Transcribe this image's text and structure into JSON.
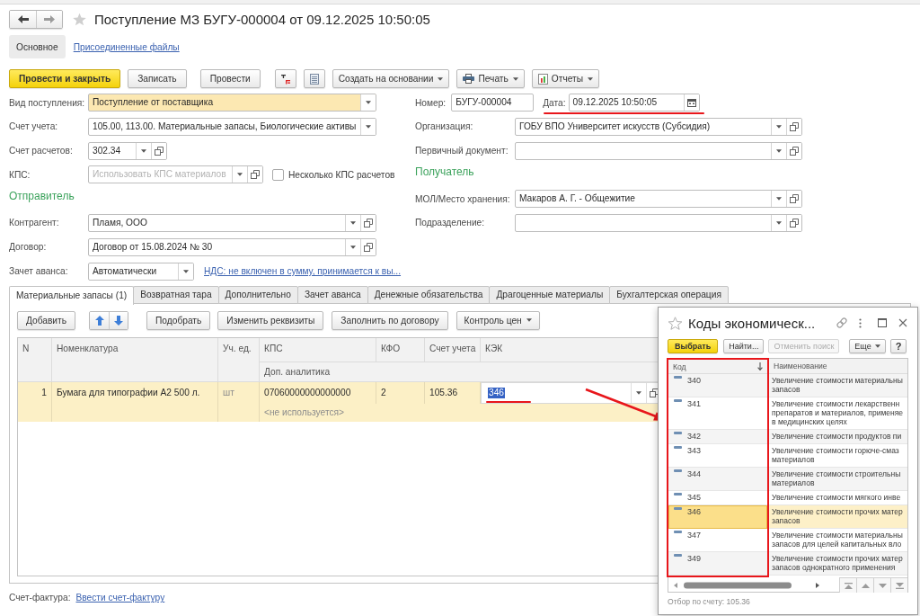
{
  "window": {
    "title": "Поступление МЗ БУГУ-000004 от 09.12.2025 10:50:05",
    "favorite": false
  },
  "nav_tabs": [
    {
      "label": "Основное",
      "selected": true
    },
    {
      "label": "Присоединенные файлы",
      "selected": false
    }
  ],
  "toolbar": {
    "buttons": [
      {
        "label": "Провести и закрыть",
        "default": true
      },
      {
        "label": "Записать",
        "default": false
      },
      {
        "label": "Провести",
        "default": false
      }
    ],
    "menus": [
      {
        "kind": "plain",
        "label": "Создать на основании"
      },
      {
        "kind": "print",
        "label": "Печать"
      },
      {
        "kind": "reports",
        "label": "Отчеты"
      }
    ]
  },
  "left_form": [
    {
      "kind": "select",
      "label": "Вид поступления:",
      "value": "Поступление от поставщика",
      "highlighted": true
    },
    {
      "kind": "select",
      "label": "Счет учета:",
      "value": "105.00, 113.00. Материальные запасы, Биологические активы",
      "highlighted": false
    },
    {
      "kind": "reference",
      "label": "Счет расчетов:",
      "value": "302.34",
      "highlighted": false
    },
    {
      "kind": "reference",
      "label": "КПС:",
      "placeholder": "Использовать КПС материалов",
      "highlighted": false,
      "checkbox": {
        "label": "Несколько КПС расчетов",
        "checked": false
      }
    },
    {
      "kind": "heading",
      "label": "Отправитель"
    },
    {
      "kind": "reference",
      "label": "Контрагент:",
      "value": "Пламя, ООО",
      "highlighted": false
    },
    {
      "kind": "reference",
      "label": "Договор:",
      "value": "Договор от 15.08.2024 № 30",
      "highlighted": false
    },
    {
      "kind": "select",
      "label": "Зачет аванса:",
      "value": "Автоматически",
      "highlighted": false,
      "link": "НДС: не включен в сумму, принимается к вы..."
    }
  ],
  "right_form": [
    {
      "kind": "number_date",
      "number": {
        "label": "Номер:",
        "value": "БУГУ-000004"
      },
      "date": {
        "label": "Дата:",
        "value": "09.12.2025 10:50:05",
        "marked": true
      }
    },
    {
      "kind": "reference",
      "label": "Организация:",
      "value": "ГОБУ ВПО Университет искусств (Субсидия)",
      "highlighted": false
    },
    {
      "kind": "reference",
      "label": "Первичный документ:",
      "highlighted": false
    },
    {
      "kind": "heading",
      "label": "Получатель"
    },
    {
      "kind": "reference",
      "label": "МОЛ/Место хранения:",
      "value": "Макаров А. Г. - Общежитие",
      "highlighted": false
    },
    {
      "kind": "reference",
      "label": "Подразделение:",
      "highlighted": false
    }
  ],
  "section_tabs": [
    {
      "label": "Материальные запасы (1)",
      "selected": true
    },
    {
      "label": "Возвратная тара",
      "selected": false
    },
    {
      "label": "Дополнительно",
      "selected": false
    },
    {
      "label": "Зачет аванса",
      "selected": false
    },
    {
      "label": "Денежные обязательства",
      "selected": false
    },
    {
      "label": "Драгоценные материалы",
      "selected": false
    },
    {
      "label": "Бухгалтерская операция",
      "selected": false
    }
  ],
  "table_toolbar": [
    {
      "kind": "button",
      "label": "Добавить"
    },
    {
      "kind": "move"
    },
    {
      "kind": "button",
      "label": "Подобрать"
    },
    {
      "kind": "button",
      "label": "Изменить реквизиты"
    },
    {
      "kind": "button",
      "label": "Заполнить по договору"
    },
    {
      "kind": "menu",
      "label": "Контроль цен"
    }
  ],
  "table": {
    "columns": [
      "N",
      "Номенклатура",
      "Уч. ед.",
      "КПС",
      "КФО",
      "Счет учета",
      "КЭК"
    ],
    "subheader": "Доп. аналитика",
    "rows": [
      {
        "n": "1",
        "item": "Бумага для типографии А2 500 л.",
        "unit": "шт",
        "kps": "07060000000000000",
        "kfo": "2",
        "account": "105.36",
        "kek": {
          "value": "346",
          "editing": true,
          "marked": true
        },
        "analytics": "<не используется>",
        "selected": true
      }
    ]
  },
  "invoice": {
    "label": "Счет-фактура:",
    "link": "Ввести счет-фактуру"
  },
  "popup": {
    "title": "Коды экономическ...",
    "favorite": false,
    "buttons": [
      {
        "label": "Выбрать",
        "default": true,
        "disabled": false
      },
      {
        "label": "Найти...",
        "default": false,
        "disabled": false
      },
      {
        "label": "Отменить поиск",
        "default": false,
        "disabled": true
      }
    ],
    "more_menu": "Еще",
    "help": "?",
    "columns": [
      "Код",
      "Наименование"
    ],
    "code_column_marked": true,
    "rows": [
      {
        "code": "340",
        "name": "Увеличение стоимости материальны\nзапасов",
        "selected": false
      },
      {
        "code": "341",
        "name": "Увеличение стоимости лекарственн\nпрепаратов и материалов, применяе\nв медицинских целях",
        "selected": false
      },
      {
        "code": "342",
        "name": "Увеличение стоимости продуктов пи",
        "selected": false
      },
      {
        "code": "343",
        "name": "Увеличение стоимости горюче-смаз\nматериалов",
        "selected": false
      },
      {
        "code": "344",
        "name": "Увеличение стоимости строительны\nматериалов",
        "selected": false
      },
      {
        "code": "345",
        "name": "Увеличение стоимости мягкого инве",
        "selected": false
      },
      {
        "code": "346",
        "name": "Увеличение стоимости прочих матер\nзапасов",
        "selected": true
      },
      {
        "code": "347",
        "name": "Увеличение стоимости материальны\nзапасов для целей капитальных вло",
        "selected": false
      },
      {
        "code": "349",
        "name": "Увеличение стоимости прочих матер\nзапасов однократного применения",
        "selected": false
      }
    ],
    "filter": "Отбор по счету: 105.36"
  }
}
